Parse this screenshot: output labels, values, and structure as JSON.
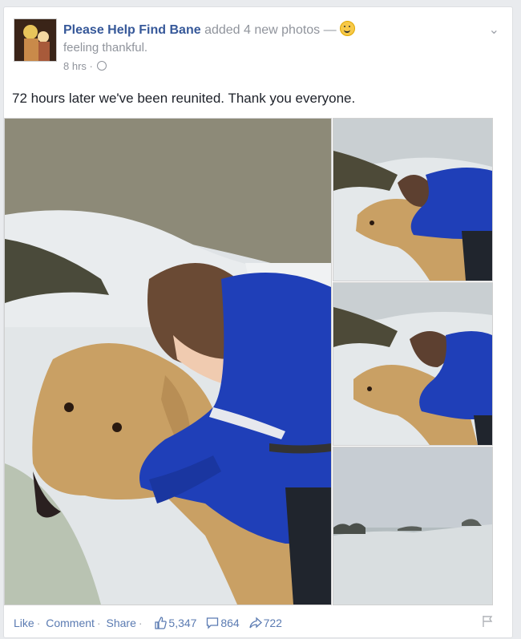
{
  "post": {
    "author": "Please Help Find Bane",
    "action": "added 4 new photos —",
    "feeling_icon": "smiley-icon",
    "feeling": "feeling thankful.",
    "time": "8 hrs ·",
    "privacy_icon": "globe-icon",
    "text": "72 hours later we've been reunited. Thank you everyone."
  },
  "photos": [
    {
      "name": "photo-main",
      "subject": "boy in blue hoodie hugging a yellow labrador on snowy grass"
    },
    {
      "name": "photo-2",
      "subject": "boy hugging dog on snowy grass"
    },
    {
      "name": "photo-3",
      "subject": "boy hugging dog close-up"
    },
    {
      "name": "photo-4",
      "subject": "snowy field under grey sky"
    }
  ],
  "actions": {
    "like": "Like",
    "comment": "Comment",
    "share": "Share",
    "likes_count": "5,347",
    "comments_count": "864",
    "shares_count": "722"
  },
  "colors": {
    "link": "#365899",
    "meta": "#90949c",
    "background": "#e9ebee"
  }
}
